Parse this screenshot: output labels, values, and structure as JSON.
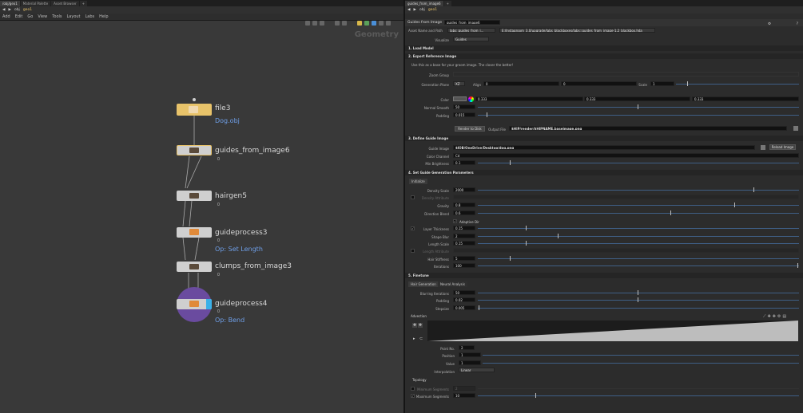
{
  "left": {
    "tabs": [
      "/obj/geo1",
      "Material Palette",
      "Asset Browser"
    ],
    "path": [
      "obj",
      "geo1"
    ],
    "menu": [
      "Add",
      "Edit",
      "Go",
      "View",
      "Tools",
      "Layout",
      "Labs",
      "Help"
    ],
    "context_label": "Geometry",
    "nodes": [
      {
        "name": "file3",
        "sub": "Dog.obj"
      },
      {
        "name": "guides_from_image6",
        "sub": ""
      },
      {
        "name": "hairgen5",
        "sub": ""
      },
      {
        "name": "guideprocess3",
        "sub": "Op: Set Length"
      },
      {
        "name": "clumps_from_image3",
        "sub": ""
      },
      {
        "name": "guideprocess4",
        "sub": "Op: Bend"
      }
    ]
  },
  "right": {
    "tabs": [
      "guides_from_image6"
    ],
    "path": [
      "obj",
      "geo1"
    ],
    "header": {
      "type_label": "Guides from Image",
      "node_name": "guides_from_image6"
    },
    "asset": {
      "label": "Asset Name and Path",
      "name": "labs::guides_from_i...",
      "path": "E:/Instagroom_3.0/upgrade/labs_blackboxes/labs::guides_from_image-1.2_blackbox.hda"
    },
    "visualize": {
      "label": "Visualize",
      "value": "Guides"
    },
    "sections": {
      "s1": "1. Load Model",
      "s2": "2. Export Reference Image",
      "s3": "3. Define Guide Image",
      "s4": "4. Set Guide Generation Parameters",
      "s5": "5. Finetune"
    },
    "s2": {
      "hint": "Use this as a base for your groom image. The closer the better!",
      "zoom_group": "Zoom Group",
      "gen_plane_label": "Generation Plane",
      "gen_plane": "XZ",
      "align_label": "Align",
      "align_x": "0",
      "align_y": "0",
      "scale_label": "Scale",
      "scale": "1",
      "color_label": "Color",
      "color_r": "0.333",
      "color_g": "0.333",
      "color_b": "0.333",
      "normal_smooth_label": "Normal Smooth",
      "normal_smooth": "50",
      "padding_label": "Padding",
      "padding": "0.015",
      "render_btn": "Render to Disk",
      "output_label": "Output File",
      "output": "$HIP/render/$HIPNAME.baseimage.png"
    },
    "s3": {
      "guide_image_label": "Guide Image",
      "guide_image": "$JOB/OneDrive/Desktop/dog.png",
      "reload_btn": "Reload Image",
      "color_channel_label": "Color Channel",
      "color_channel": "Cd",
      "min_brightness_label": "Min Brightness",
      "min_brightness": "0.1"
    },
    "s4": {
      "initialize": "Initialize",
      "density_scale_label": "Density Scale",
      "density_scale": "2000",
      "density_attr_label": "Density Attribute",
      "gravity_label": "Gravity",
      "gravity": "0.8",
      "direction_blend_label": "Direction Blend",
      "direction_blend": "0.6",
      "adaptive_label": "Adaptive Dir",
      "layer_thickness_label": "Layer Thickness",
      "layer_thickness": "0.15",
      "shape_blur_label": "Shape Blur",
      "shape_blur": "2",
      "length_scale_label": "Length Scale",
      "length_scale": "0.15",
      "length_attr_label": "Length Attribute",
      "hair_stiffness_label": "Hair Stiffness",
      "hair_stiffness": "5",
      "iterations_label": "Iterations",
      "iterations": "100"
    },
    "s5": {
      "subtabs": [
        "Hair Generation",
        "Neural Analysis"
      ],
      "blurring_label": "Blurring Iterations",
      "blurring": "50",
      "padding_label": "Padding",
      "padding": "0.02",
      "stepsize_label": "Stepsize",
      "stepsize": "0.005",
      "advection_label": "Advection",
      "point_no_label": "Point No.",
      "point_no": "2",
      "position_label": "Position",
      "position": "1",
      "value_label": "Value",
      "value": "1",
      "interp_label": "Interpolation",
      "interp": "Linear",
      "topology_label": "Topology",
      "min_seg_label": "Minimum Segments",
      "min_seg": "2",
      "max_seg_label": "Maximum Segments",
      "max_seg": "10"
    }
  },
  "colors": {
    "accent_blue": "#6f9fe8",
    "slider_blue": "#3f5f86",
    "node_gold": "#e8c36a",
    "node_purple": "#6a4b9f"
  }
}
